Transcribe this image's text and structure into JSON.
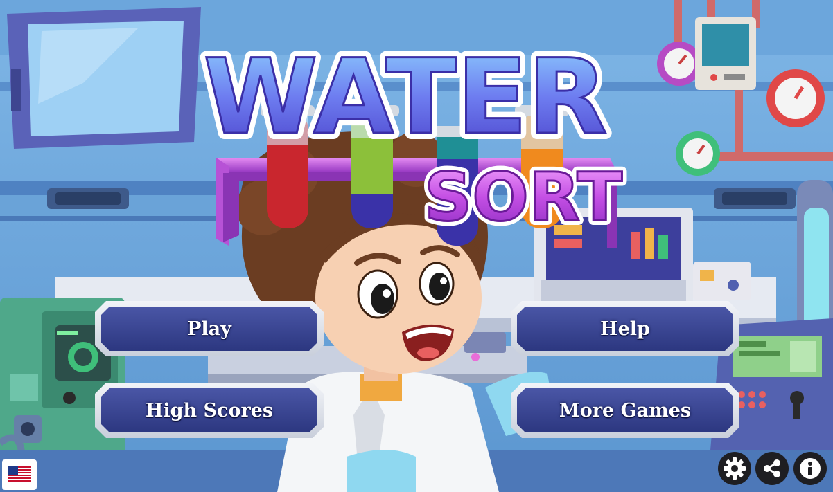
{
  "game": {
    "title_top": "WATER",
    "title_bottom": "SORT"
  },
  "menu": {
    "play": "Play",
    "help": "Help",
    "high_scores": "High Scores",
    "more_games": "More Games"
  },
  "icons": {
    "settings": "gear-icon",
    "share": "share-icon",
    "info": "info-icon",
    "language": "us-flag-icon"
  },
  "colors": {
    "button_face": "#34408c",
    "button_border": "#dde1ea",
    "title_fill": "#6a74e8",
    "sort_fill": "#c24ee0",
    "tube_red": "#c9262e",
    "tube_green": "#8cc03a",
    "tube_blue": "#3a32a8",
    "tube_teal": "#1f8f95",
    "tube_orange": "#f08a1e"
  }
}
